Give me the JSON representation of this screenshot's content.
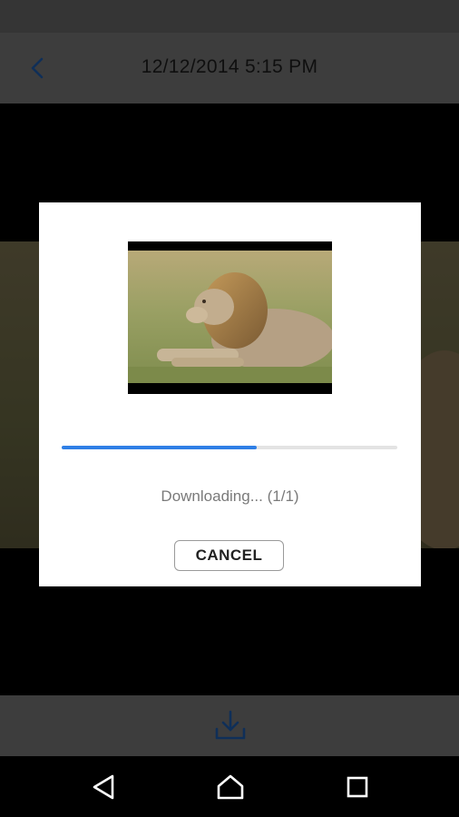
{
  "header": {
    "title": "12/12/2014 5:15 PM",
    "back_icon": "chevron-left-icon",
    "accent_color": "#1f5fb0"
  },
  "dialog": {
    "progress_text": "Downloading... (1/1)",
    "progress_fraction": 0.58,
    "cancel_label": "CANCEL",
    "thumbnail_subject": "lion"
  },
  "toolbar": {
    "download_icon": "download-icon"
  },
  "navigation": {
    "back_icon": "nav-back-icon",
    "home_icon": "nav-home-icon",
    "recents_icon": "nav-recents-icon"
  }
}
